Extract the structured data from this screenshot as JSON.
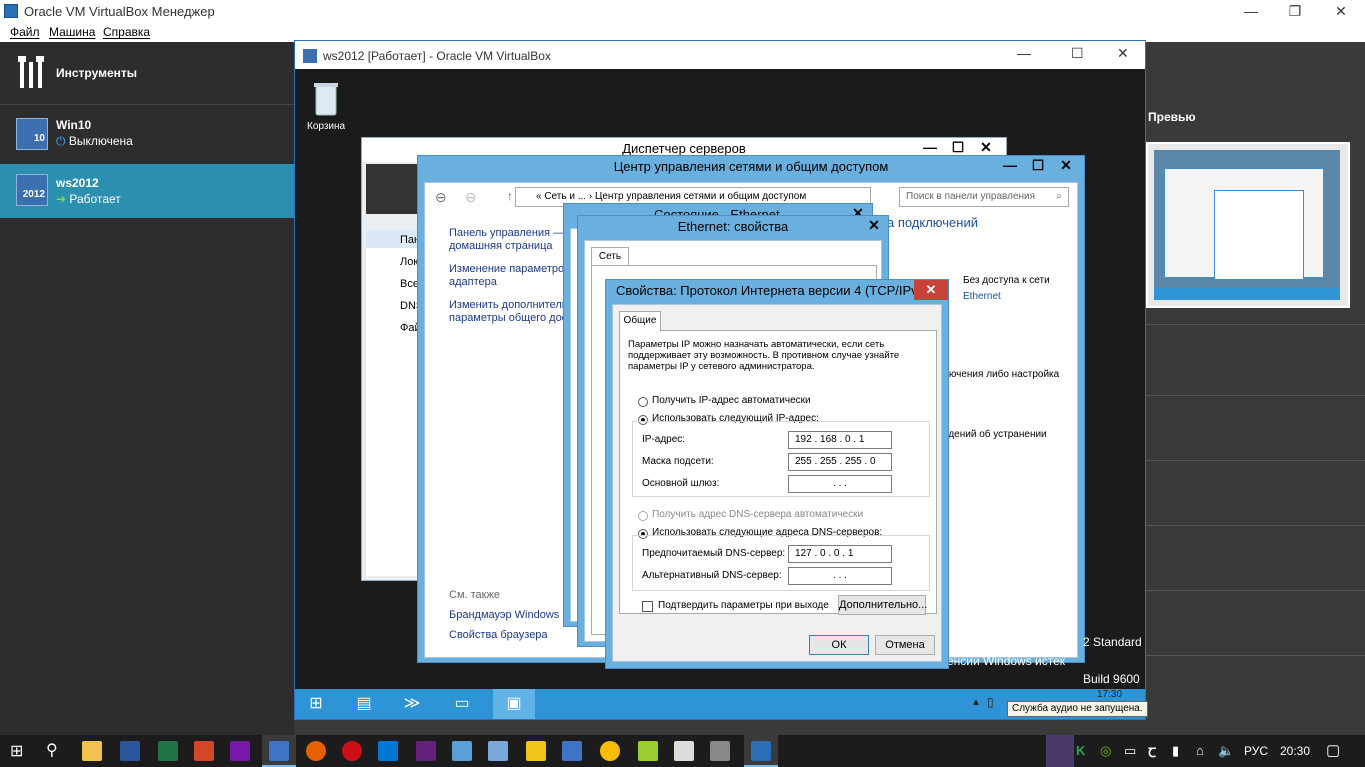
{
  "vbm": {
    "title": "Oracle VM VirtualBox Менеджер",
    "menu": [
      "Файл",
      "Машина",
      "Справка"
    ],
    "tools_label": "Инструменты",
    "vms": [
      {
        "name": "Win10",
        "status": "Выключена",
        "badge": "10"
      },
      {
        "name": "ws2012",
        "status": "Работает",
        "badge": "2012"
      }
    ],
    "preview_label": "Превью"
  },
  "vm_window": {
    "title": "ws2012 [Работает] - Oracle VM VirtualBox"
  },
  "guest": {
    "recycle_bin": "Корзина",
    "server_manager_title": "Диспетчер серверов",
    "server_manager_nav": [
      "Пан",
      "Лок",
      "Все",
      "DNS",
      "Фай"
    ],
    "ncsc_title": "Центр управления сетями и общим доступом",
    "breadcrumb": "«  Сеть и ...  ›  Центр управления сетями и общим доступом",
    "search_placeholder": "Поиск в панели управления",
    "left_links": [
      "Панель управления —",
      "домашняя страница",
      "Изменение параметров",
      "адаптера",
      "Изменить дополнительные",
      "параметры общего досту"
    ],
    "see_also": "См. также",
    "see_also_links": [
      "Брандмауэр Windows",
      "Свойства браузера"
    ],
    "right_partial": {
      "connections": "ка подключений",
      "no_access": "Без доступа к сети",
      "ethernet": "Ethernet",
      "line1": "лючения либо настройка",
      "line2": "едений об устранении",
      "edition": "2 Standard",
      "license": "енсии Windows истек",
      "build": "Build 9600"
    },
    "status_title": "Состояние - Ethernet",
    "eth_props_title": "Ethernet: свойства",
    "eth_tab": "Сеть",
    "tcp": {
      "title": "Свойства: Протокол Интернета версии 4 (TCP/IPv4)",
      "tab": "Общие",
      "description": "Параметры IP можно назначать автоматически, если сеть поддерживает эту возможность. В противном случае узнайте параметры IP у сетевого администратора.",
      "auto_ip": "Получить IP-адрес автоматически",
      "manual_ip": "Использовать следующий IP-адрес:",
      "ip_label": "IP-адрес:",
      "ip_value": "192 . 168 . 0 . 1",
      "mask_label": "Маска подсети:",
      "mask_value": "255 . 255 . 255 . 0",
      "gateway_label": "Основной шлюз:",
      "gateway_value": ".   .   .",
      "auto_dns": "Получить адрес DNS-сервера автоматически",
      "manual_dns": "Использовать следующие адреса DNS-серверов:",
      "pref_dns_label": "Предпочитаемый DNS-сервер:",
      "pref_dns_value": "127 . 0 . 0 . 1",
      "alt_dns_label": "Альтернативный DNS-сервер:",
      "alt_dns_value": ".   .   .",
      "validate_label": "Подтвердить параметры при выходе",
      "advanced_button": "Дополнительно...",
      "ok_button": "ОК",
      "cancel_button": "Отмена"
    },
    "clock": "17:30",
    "tooltip": "Служба аудио не запущена."
  },
  "host_taskbar": {
    "language": "РУС",
    "time": "20:30"
  },
  "colors": {
    "vbox_selected": "#2c8fb0",
    "win8_accent": "#2e94d6",
    "dialog_frame": "#6ab0de"
  }
}
